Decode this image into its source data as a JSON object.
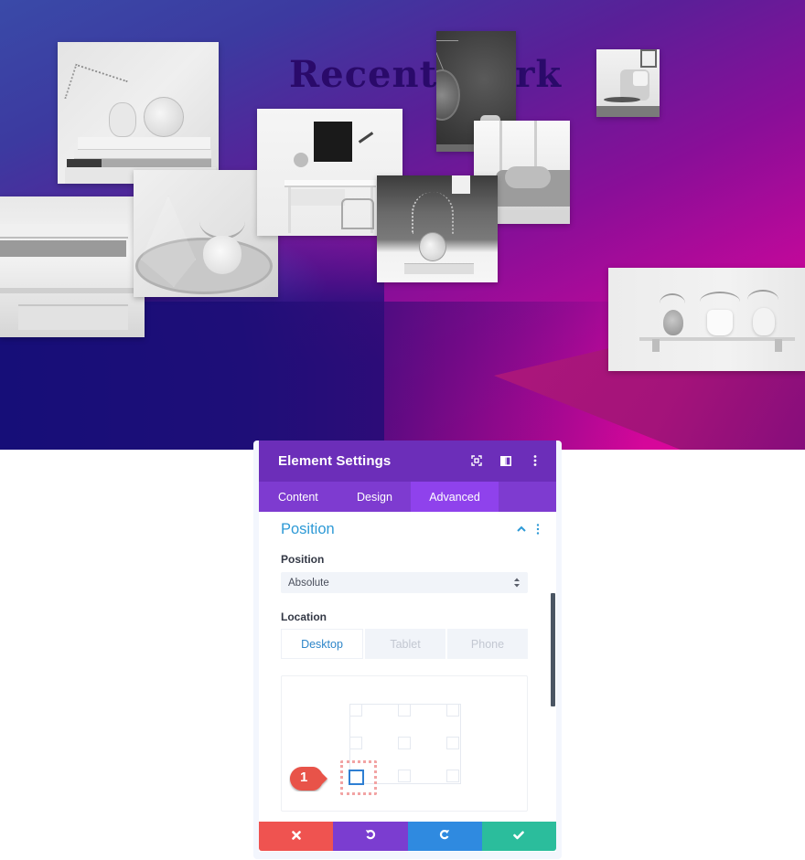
{
  "hero": {
    "title": "Recent Work",
    "photos": [
      {
        "name": "vase-baseball-books"
      },
      {
        "name": "stacked-books"
      },
      {
        "name": "air-plants-terrarium"
      },
      {
        "name": "desk-workspace"
      },
      {
        "name": "hanging-mirror"
      },
      {
        "name": "armchair-corner"
      },
      {
        "name": "sofa-window"
      },
      {
        "name": "flower-vase"
      },
      {
        "name": "plant-shelf"
      }
    ],
    "colors": {
      "gradient_start": "#3a4aa8",
      "gradient_end": "#e4069a",
      "title_color": "#2a0a6a"
    }
  },
  "settings_panel": {
    "title": "Element Settings",
    "header_icons": [
      "focus-icon",
      "split-view-icon",
      "more-vertical-icon"
    ],
    "tabs": [
      {
        "label": "Content",
        "active": false
      },
      {
        "label": "Design",
        "active": false
      },
      {
        "label": "Advanced",
        "active": true
      }
    ],
    "section": {
      "title": "Position",
      "expanded": true
    },
    "position_field": {
      "label": "Position",
      "value": "Absolute"
    },
    "location_field": {
      "label": "Location",
      "devices": [
        {
          "label": "Desktop",
          "active": true
        },
        {
          "label": "Tablet",
          "active": false
        },
        {
          "label": "Phone",
          "active": false
        }
      ],
      "selected_anchor": "bottom-left",
      "annotation_badge": "1"
    },
    "footer": {
      "buttons": [
        {
          "action": "cancel",
          "icon": "close-icon"
        },
        {
          "action": "undo",
          "icon": "undo-icon"
        },
        {
          "action": "redo",
          "icon": "redo-icon"
        },
        {
          "action": "save",
          "icon": "check-icon"
        }
      ]
    },
    "colors": {
      "header": "#6c2eb9",
      "tabs_bar": "#7e3bd0",
      "active_tab": "#8f42ec",
      "section_title": "#2e9ad6",
      "cancel": "#ef5350",
      "undo": "#7b3dd0",
      "redo": "#2f8ae0",
      "save": "#2bbd9c",
      "selected_anchor": "#2e7fd3",
      "badge": "#e8534a"
    }
  }
}
